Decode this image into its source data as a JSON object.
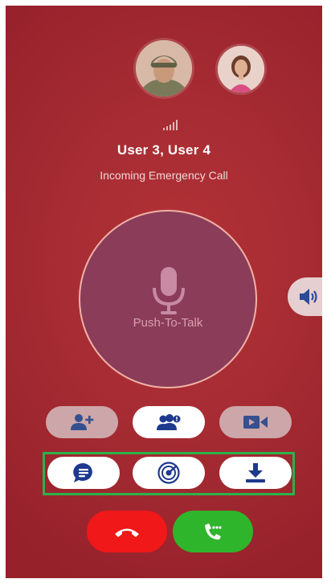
{
  "call": {
    "participants": "User 3, User 4",
    "status": "Incoming Emergency Call"
  },
  "ptt": {
    "label": "Push-To-Talk"
  },
  "icons": {
    "signal": "signal-strength-icon",
    "mic": "microphone-icon",
    "speaker": "speaker-icon",
    "add_user": "add-user-icon",
    "group": "group-users-icon",
    "video": "video-camera-icon",
    "message": "message-icon",
    "radar": "radar-icon",
    "download": "download-icon",
    "decline": "phone-hangup-icon",
    "accept": "phone-answer-icon"
  },
  "colors": {
    "background": "#a72c33",
    "ptt_circle": "#8a3c59",
    "icon_blue": "#1e3a8f",
    "decline": "#f01818",
    "accept": "#2fb52c",
    "highlight": "#2bb24a"
  }
}
